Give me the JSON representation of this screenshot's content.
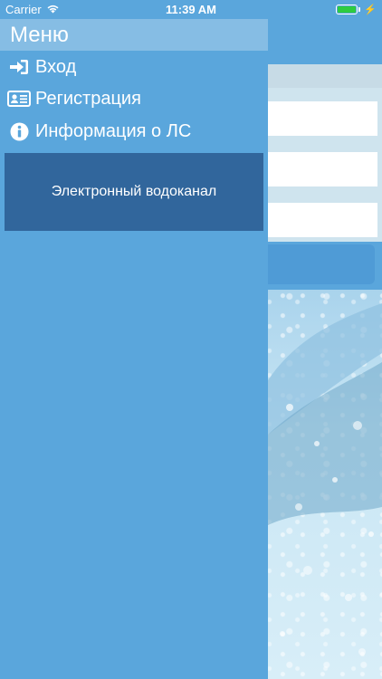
{
  "status_bar": {
    "carrier": "Carrier",
    "time": "11:39 AM"
  },
  "drawer": {
    "title": "Меню",
    "items": [
      {
        "label": "Вход",
        "icon": "sign-in-icon"
      },
      {
        "label": "Регистрация",
        "icon": "id-card-icon"
      },
      {
        "label": "Информация о ЛС",
        "icon": "info-circle-icon"
      }
    ],
    "banner": "Электронный водоканал"
  },
  "colors": {
    "drawer_background": "#5aa6dc",
    "title_bar": "#86bde4",
    "banner": "#31669c"
  }
}
